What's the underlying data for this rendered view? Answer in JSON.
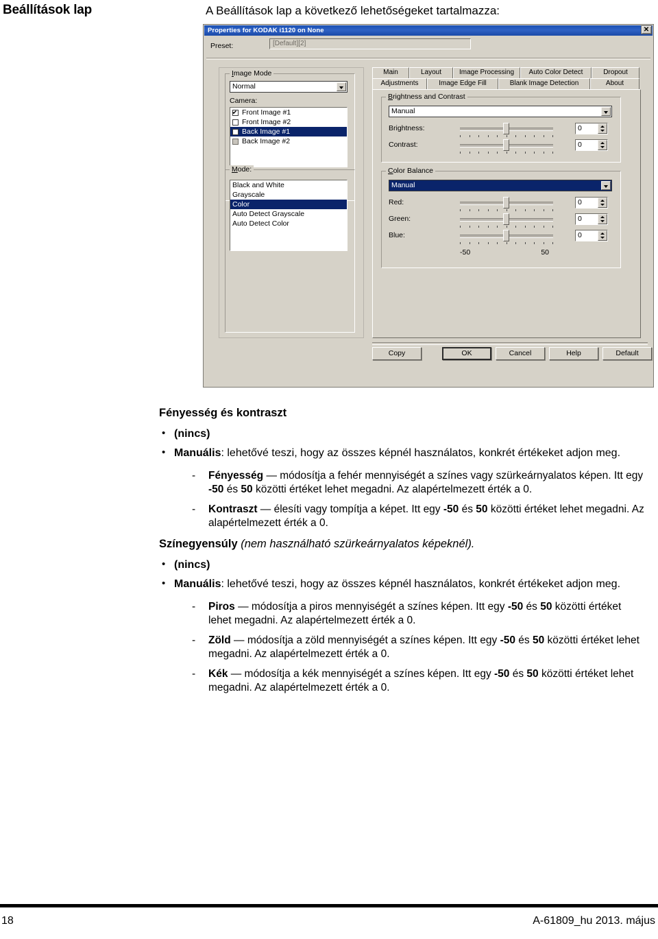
{
  "page": {
    "header_title": "Beállítások lap",
    "header_intro": "A Beállítások lap a következő lehetőségeket tartalmazza:",
    "footer_page_number": "18",
    "footer_doc_id": "A-61809_hu 2013. május"
  },
  "dialog": {
    "title": "Properties for KODAK i1120 on None",
    "close_label": "✕",
    "preset": {
      "label": "Preset:",
      "value": "[Default][2]"
    },
    "image_mode": {
      "legend": "Image Mode",
      "selected": "Normal",
      "camera_label": "Camera:",
      "camera_items": [
        {
          "label": "Front Image #1",
          "checked": true,
          "selected": false,
          "disabled": false
        },
        {
          "label": "Front Image #2",
          "checked": false,
          "selected": false,
          "disabled": false
        },
        {
          "label": "Back Image #1",
          "checked": false,
          "selected": true,
          "disabled": false
        },
        {
          "label": "Back Image #2",
          "checked": false,
          "selected": false,
          "disabled": true
        }
      ]
    },
    "mode": {
      "legend": "Mode:",
      "items": [
        {
          "label": "Black and White",
          "selected": false
        },
        {
          "label": "Grayscale",
          "selected": false
        },
        {
          "label": "Color",
          "selected": true
        },
        {
          "label": "Auto Detect Grayscale",
          "selected": false
        },
        {
          "label": "Auto Detect Color",
          "selected": false
        }
      ]
    },
    "tabs_row1": [
      {
        "label": "Main",
        "active": false
      },
      {
        "label": "Layout",
        "active": false
      },
      {
        "label": "Image Processing",
        "active": false
      },
      {
        "label": "Auto Color Detect",
        "active": false
      },
      {
        "label": "Dropout",
        "active": false
      }
    ],
    "tabs_row2": [
      {
        "label": "Adjustments",
        "active": true
      },
      {
        "label": "Image Edge Fill",
        "active": false
      },
      {
        "label": "Blank Image Detection",
        "active": false
      },
      {
        "label": "About",
        "active": false
      }
    ],
    "brightness_contrast": {
      "legend": "Brightness and Contrast",
      "mode_value": "Manual",
      "sliders": [
        {
          "label": "Brightness:",
          "value": "0"
        },
        {
          "label": "Contrast:",
          "value": "0"
        }
      ]
    },
    "color_balance": {
      "legend": "Color Balance",
      "mode_value": "Manual",
      "sliders": [
        {
          "label": "Red:",
          "value": "0"
        },
        {
          "label": "Green:",
          "value": "0"
        },
        {
          "label": "Blue:",
          "value": "0"
        }
      ],
      "range_min": "-50",
      "range_max": "50"
    },
    "buttons": [
      {
        "label": "Copy",
        "default": false
      },
      {
        "label": "OK",
        "default": true
      },
      {
        "label": "Cancel",
        "default": false
      },
      {
        "label": "Help",
        "default": false
      },
      {
        "label": "Default",
        "default": false
      }
    ],
    "colors": {
      "titlebar": "#1b51b5",
      "selection": "#0a246a",
      "face": "#d6d2c8"
    }
  },
  "body": {
    "section1": {
      "heading": "Fényesség és kontraszt",
      "bullet1": "(nincs)",
      "bullet2_bold": "Manuális",
      "bullet2_rest": ": lehetővé teszi, hogy az összes képnél használatos, konkrét értékeket adjon meg.",
      "dash1_bold": "Fényesség",
      "dash1_rest_a": " — módosítja a fehér mennyiségét a színes vagy szürkeárnyalatos képen. Itt egy ",
      "dash1_b1": "-50",
      "dash1_rest_b": " és ",
      "dash1_b2": "50",
      "dash1_rest_c": " közötti értéket lehet megadni. Az alapértelmezett érték a 0.",
      "dash2_bold": "Kontraszt",
      "dash2_rest_a": " — élesíti vagy tompítja a képet. Itt egy ",
      "dash2_b1": "-50",
      "dash2_rest_b": " és ",
      "dash2_b2": "50",
      "dash2_rest_c": " közötti értéket lehet megadni. Az alapértelmezett érték a 0."
    },
    "section2": {
      "heading_bold": "Színegyensúly",
      "heading_italic": " (nem használható szürkeárnyalatos képeknél).",
      "bullet1": "(nincs)",
      "bullet2_bold": "Manuális",
      "bullet2_rest": ": lehetővé teszi, hogy az összes képnél használatos, konkrét értékeket adjon meg.",
      "dash1_bold": "Piros",
      "dash1_rest_a": " — módosítja a piros mennyiségét a színes képen. Itt egy ",
      "dash1_b1": "-50",
      "dash1_rest_b": " és ",
      "dash1_b2": "50",
      "dash1_rest_c": " közötti értéket lehet megadni. Az alapértelmezett érték a 0.",
      "dash2_bold": "Zöld",
      "dash2_rest_a": " — módosítja a zöld mennyiségét a színes képen. Itt egy ",
      "dash2_b1": "-50",
      "dash2_rest_b": " és ",
      "dash2_b2": "50",
      "dash2_rest_c": " közötti értéket lehet megadni. Az alapértelmezett érték a 0.",
      "dash3_bold": "Kék",
      "dash3_rest_a": " — módosítja a kék mennyiségét a színes képen. Itt egy ",
      "dash3_b1": "-50",
      "dash3_rest_b": " és ",
      "dash3_b2": "50",
      "dash3_rest_c": " közötti értéket lehet megadni. Az alapértelmezett érték a 0."
    }
  }
}
